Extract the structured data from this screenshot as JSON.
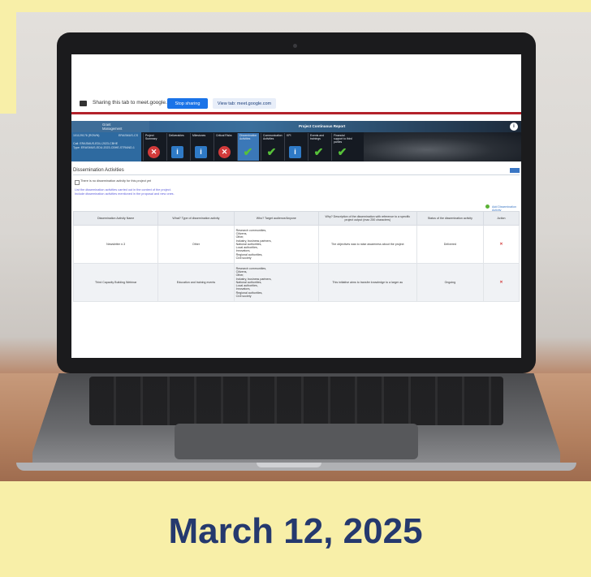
{
  "caption": {
    "date": "March 12, 2025"
  },
  "browser": {
    "share_text": "Sharing this tab to meet.google.com",
    "stop_sharing": "Stop sharing",
    "view_tab": "View tab: meet.google.com"
  },
  "app": {
    "logo_line1": "Grant",
    "logo_line2": "Management",
    "report_title": "Project Continuous Report",
    "help_label": "HOW",
    "project": {
      "line1": "101129176 (ROWN)",
      "line1_right": "ERASMUS-CS",
      "line2": "Call: ERASMUS-EDU-2023-CBHE",
      "line3": "Type: ERASMUS-EDU-2023-CBHE-STRAND-1"
    },
    "steps": [
      {
        "label": "Project Summary",
        "status": "err",
        "active": false
      },
      {
        "label": "Deliverables",
        "status": "info",
        "active": false
      },
      {
        "label": "Milestones",
        "status": "info",
        "active": false
      },
      {
        "label": "Critical Risks",
        "status": "err",
        "active": false
      },
      {
        "label": "Dissemination Activities",
        "status": "ok",
        "active": true
      },
      {
        "label": "Communication Activities",
        "status": "ok",
        "active": false
      },
      {
        "label": "KPI",
        "status": "info",
        "active": false
      },
      {
        "label": "Events and trainings",
        "status": "ok",
        "active": false
      },
      {
        "label": "Financial support to third parties",
        "status": "ok",
        "active": false
      }
    ]
  },
  "section": {
    "title": "Dissemination Activities",
    "no_activity": "There is no dissemination activity for this project yet",
    "note_line1": "List the dissemination activities carried out in the context of the project.",
    "note_line2": "Include dissemination activities mentioned in the proposal and new ones.",
    "add_link": "Add Dissemination Activity"
  },
  "table": {
    "headers": [
      "Dissemination Activity Name",
      "What? Type of dissemination activity",
      "Who? Target audience/Anyone",
      "Why? Description of the dissemination with reference to a specific project output (max 250 characters)",
      "Status of the dissemination activity",
      "Action"
    ],
    "rows": [
      {
        "name": "Newsletter n.3",
        "type": "Other",
        "audience": [
          "Research communities,",
          "Citizens,",
          "Other,",
          "Industry, business partners,",
          "National authorities,",
          "Local authorities,",
          "Innovators,",
          "Regional authorities,",
          "Civil society"
        ],
        "why": "The objectives was to raise awareness about the project",
        "status": "Delivered"
      },
      {
        "name": "Third Capacity Building Webinar",
        "type": "Education and training events",
        "audience": [
          "Research communities,",
          "Citizens,",
          "Other,",
          "Industry, business partners,",
          "National authorities,",
          "Local authorities,",
          "Innovators,",
          "Regional authorities,",
          "Civil society"
        ],
        "why": "This initiative aims to transfer knowledge to a larger au",
        "status": "Ongoing"
      }
    ]
  },
  "colors": {
    "caption_bg": "#f8efa8",
    "caption_text": "#25396e",
    "accent_blue": "#1a73e8",
    "error_red": "#d33b3b",
    "ok_green": "#57c13a"
  }
}
